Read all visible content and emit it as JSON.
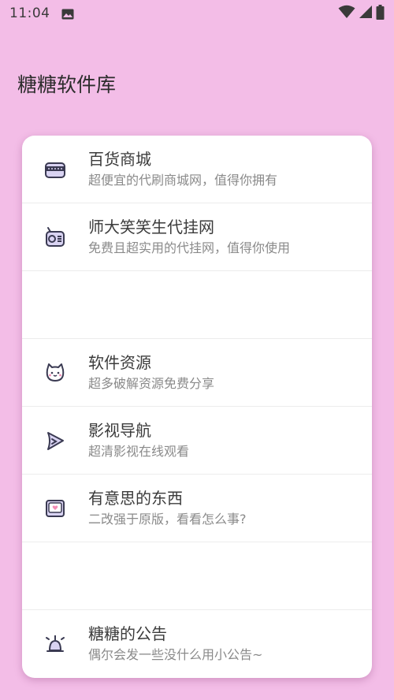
{
  "status_bar": {
    "time": "11:04",
    "icons": [
      "photo-icon",
      "wifi-icon",
      "signal-icon",
      "battery-icon"
    ]
  },
  "app": {
    "title": "糖糖软件库"
  },
  "colors": {
    "background": "#f3bde7",
    "card": "#ffffff",
    "icon_fill": "#d9d3f2",
    "icon_stroke": "#3a3a52",
    "icon_accent": "#f28bb5"
  },
  "items": [
    {
      "icon": "store-icon",
      "title": "百货商城",
      "subtitle": "超便宜的代刷商城网，值得你拥有"
    },
    {
      "icon": "radio-icon",
      "title": "师大笑笑生代挂网",
      "subtitle": "免费且超实用的代挂网，值得你使用"
    },
    {
      "empty": true
    },
    {
      "icon": "cat-icon",
      "title": "软件资源",
      "subtitle": "超多破解资源免费分享"
    },
    {
      "icon": "play-icon",
      "title": "影视导航",
      "subtitle": "超清影视在线观看"
    },
    {
      "icon": "heart-box-icon",
      "title": "有意思的东西",
      "subtitle": "二改强于原版，看看怎么事?"
    },
    {
      "empty": true
    },
    {
      "icon": "bell-icon",
      "title": "糖糖的公告",
      "subtitle": "偶尔会发一些没什么用小公告~"
    }
  ]
}
